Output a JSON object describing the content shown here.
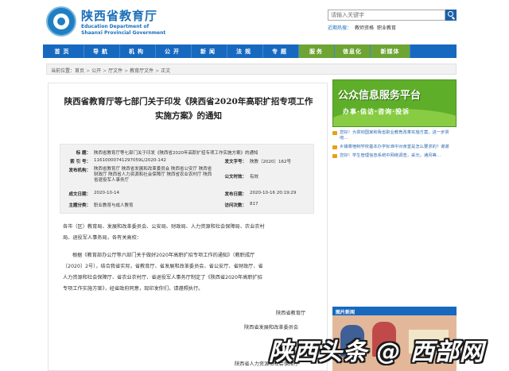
{
  "header": {
    "logo_cn": "陕西省教育厅",
    "logo_en_line1": "Education Department of",
    "logo_en_line2": "Shaanxi Provincial Government",
    "search_placeholder": "请输入关键字",
    "hot_label": "近期热搜：",
    "hot_words": [
      "教师资格",
      "职业教育"
    ]
  },
  "nav": {
    "items": [
      "首页",
      "导航",
      "机构",
      "公开",
      "新闻",
      "法规",
      "专题"
    ],
    "green_items": [
      "服务",
      "信息化",
      "新媒体"
    ]
  },
  "breadcrumb": {
    "prefix": "当前位置：",
    "items": [
      "首页",
      "公开",
      "厅文件",
      "教育厅文件",
      "正文"
    ]
  },
  "article": {
    "title_line1": "陕西省教育厅等七部门关于印发《陕西省2020年高职扩招专项工作",
    "title_line2": "实施方案》的通知",
    "meta": {
      "subject_k": "标    题：",
      "subject_v": "陕西省教育厅等七部门关于印发《陕西省2020年高职扩招专项工作实施方案》的通知",
      "index_k": "索 引 号：",
      "index_v": "11610000741297059L/2020-142",
      "docno_k": "发文字号：",
      "docno_v": "陕教〔2020〕162号",
      "issuer_k": "发布机构：",
      "issuer_v": "陕西省教育厅 陕西省发展和改革委员会 陕西省公安厅 陕西省财政厅 陕西省人力资源和社会保障厅 陕西省农业农村厅 陕西省退役军人事务厅",
      "validity_k": "公文时效：",
      "validity_v": "有效",
      "date_k": "成文日期：",
      "date_v": "2020-10-14",
      "pubdate_k": "发布日期：",
      "pubdate_v": "2020-10-16 20:19:29",
      "category_k": "主题分类：",
      "category_v": "职业教育与成人教育",
      "views_k": "访问次数：",
      "views_v": "817"
    },
    "para1_line1": "各市（区）教育局、发展和改革委员会、公安局、财政局、人力资源和社会保障局、农业农村",
    "para1_line2": "局、退役军人事务局，各有关高校：",
    "para2_line1": "根据《教育部办公厅等六部门关于做好2020年高职扩招专项工作的通知》（教职成厅",
    "para2_line2": "〔2020〕2号），结合我省实际，省教育厅、省发展和改革委员会、省公安厅、省财政厅、省",
    "para2_line3": "人力资源和社会保障厅、省农业农村厅、省退役军人事务厅制定了《陕西省2020年高职扩招",
    "para2_line4": "专项工作实施方案》，经省政府同意，现印发你们，请遵照执行。",
    "sign1": "陕西省教育厅",
    "sign2": "陕西省发展和改革委员会",
    "sign3": "陕西省人力资源和社会保障厅"
  },
  "sidebar": {
    "banner_title": "公众信息服务平台",
    "banner_sub": "办事·信访·咨询·投诉",
    "qa_items": [
      "您好！为贯彻国家和我省职业教育改革实施方案，进一步贯彻…",
      "乡镇寄宿制学校基本办学标准中对食堂是怎么要求的？谢谢",
      "您好！学生管理信息系统中网络调查，采光，通风等…"
    ],
    "pic_header": "图片新闻"
  },
  "watermark": "陕西头条 @ 西部网",
  "colors": {
    "nav_blue": "#1769c0",
    "nav_green": "#6da434",
    "brand_blue": "#1b6fb8",
    "banner_green": "#5fae2a"
  }
}
